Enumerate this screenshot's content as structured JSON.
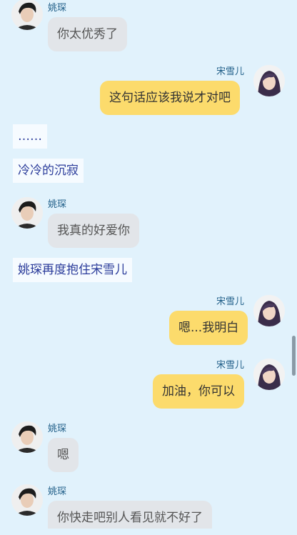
{
  "characters": {
    "yao": {
      "name": "姚琛"
    },
    "song": {
      "name": "宋雪儿"
    }
  },
  "messages": [
    {
      "type": "left",
      "speaker": "姚琛",
      "text": "你太优秀了"
    },
    {
      "type": "right",
      "speaker": "宋雪儿",
      "text": "这句话应该我说才对吧"
    },
    {
      "type": "narration",
      "text": "……"
    },
    {
      "type": "narration",
      "text": "冷冷的沉寂"
    },
    {
      "type": "left",
      "speaker": "姚琛",
      "text": "我真的好爱你"
    },
    {
      "type": "narration",
      "text": "姚琛再度抱住宋雪儿"
    },
    {
      "type": "right",
      "speaker": "宋雪儿",
      "text": "嗯...我明白"
    },
    {
      "type": "right",
      "speaker": "宋雪儿",
      "text": "加油，你可以"
    },
    {
      "type": "left",
      "speaker": "姚琛",
      "text": "嗯"
    },
    {
      "type": "left",
      "speaker": "姚琛",
      "text": "你快走吧别人看见就不好了"
    }
  ]
}
